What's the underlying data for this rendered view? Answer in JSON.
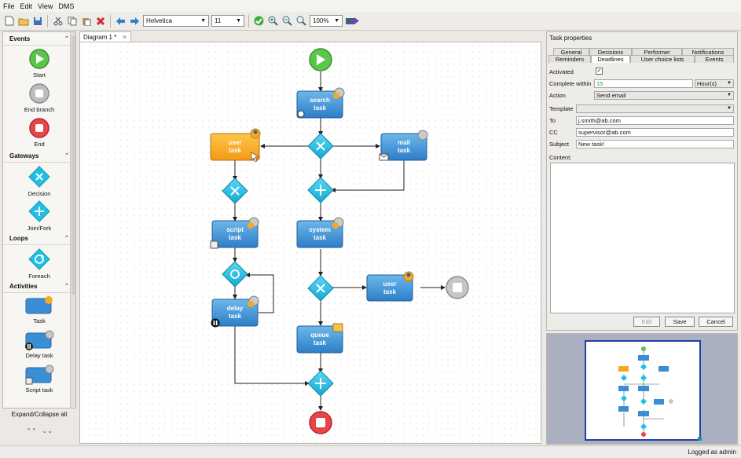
{
  "menu": {
    "file": "File",
    "edit": "Edit",
    "view": "View",
    "dms": "DMS"
  },
  "toolbar": {
    "font": "Helvetica",
    "size": "11",
    "zoom": "100%"
  },
  "palette": {
    "events": {
      "title": "Events",
      "start": "Start",
      "end_branch": "End branch",
      "end": "End"
    },
    "gateways": {
      "title": "Gateways",
      "decision": "Decision",
      "join_fork": "Join/Fork"
    },
    "loops": {
      "title": "Loops",
      "foreach": "Foreach"
    },
    "activities": {
      "title": "Activities",
      "task": "Task",
      "delay_task": "Delay task",
      "script_task": "Script task"
    },
    "expand": "Expand/Collapse all"
  },
  "doc_tab": {
    "label": "Diagram 1 *"
  },
  "diagram": {
    "search_task": [
      "search",
      "task"
    ],
    "user_task_1": [
      "user",
      "task"
    ],
    "mail_task": [
      "mail",
      "task"
    ],
    "script_task": [
      "script",
      "task"
    ],
    "system_task": [
      "system",
      "task"
    ],
    "delay_task": [
      "delay",
      "task"
    ],
    "user_task_2": [
      "user",
      "task"
    ],
    "queue_task": [
      "queue",
      "task"
    ]
  },
  "props": {
    "title": "Task properties",
    "tabs_top": [
      "General",
      "Decisions",
      "Performer",
      "Notifications"
    ],
    "tabs_bottom": [
      "Reminders",
      "Deadlines",
      "User choice lists",
      "Events"
    ],
    "active_tab": "Deadlines",
    "activated_label": "Activated",
    "complete_label": "Complete within",
    "complete_value": "15",
    "unit": "Hour(s)",
    "action_label": "Action",
    "action_value": "Send email",
    "template_label": "Template",
    "template_value": "",
    "to_label": "To",
    "to_value": "j.smith@ab.com",
    "cc_label": "CC",
    "cc_value": "supervisor@ab.com",
    "subject_label": "Subject",
    "subject_value": "New task!",
    "content_label": "Content:",
    "edit_btn": "Edit",
    "save_btn": "Save",
    "cancel_btn": "Cancel"
  },
  "status": {
    "logged": "Logged as admin"
  },
  "colors": {
    "task_blue": "#3a8fd4",
    "user_task_orange": "#f7a823",
    "start_green": "#5cc64a",
    "end_red": "#e8454a",
    "gateway_cyan": "#1ec1e6"
  }
}
